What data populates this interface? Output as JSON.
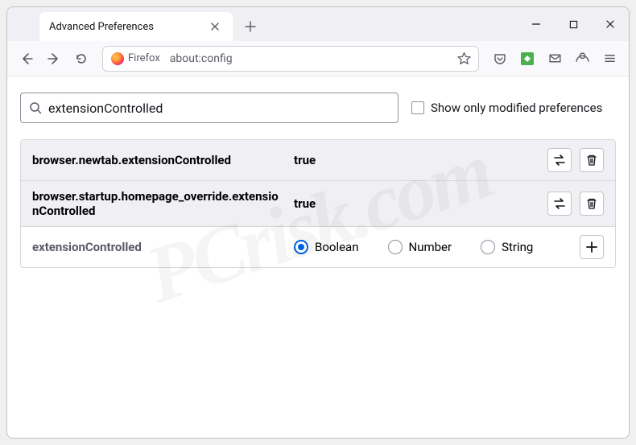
{
  "tab": {
    "title": "Advanced Preferences"
  },
  "urlbar": {
    "identity_label": "Firefox",
    "url": "about:config"
  },
  "search": {
    "value": "extensionControlled"
  },
  "checkbox": {
    "label": "Show only modified preferences"
  },
  "prefs": [
    {
      "name": "browser.newtab.extensionControlled",
      "value": "true"
    },
    {
      "name": "browser.startup.homepage_override.extensionControlled",
      "value": "true"
    }
  ],
  "new_pref": {
    "name": "extensionControlled",
    "types": {
      "boolean": "Boolean",
      "number": "Number",
      "string": "String"
    }
  },
  "watermark": "PCrisk.com"
}
